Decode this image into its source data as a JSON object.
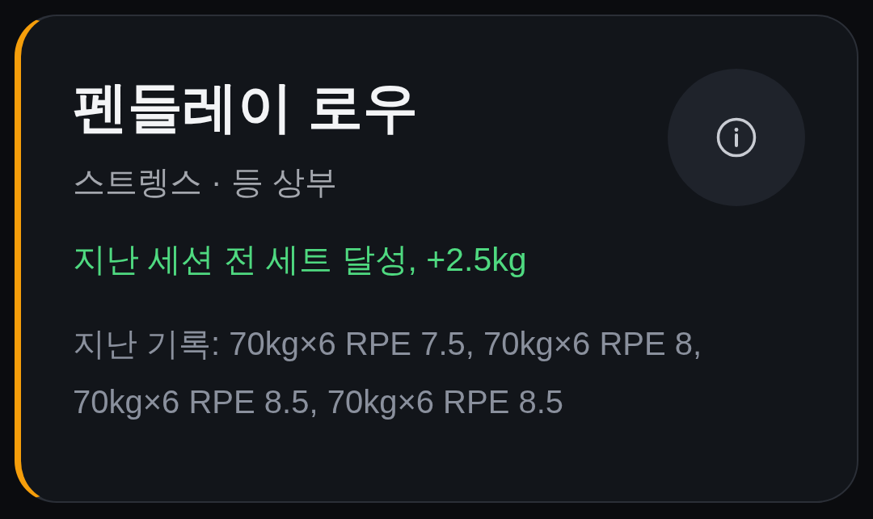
{
  "exercise": {
    "title": "펜들레이 로우",
    "subtitle": "스트렝스 · 등 상부",
    "progress_note": "지난 세션 전 세트 달성, +2.5kg",
    "history": "지난 기록: 70kg×6 RPE 7.5, 70kg×6 RPE 8, 70kg×6 RPE 8.5, 70kg×6 RPE 8.5"
  }
}
